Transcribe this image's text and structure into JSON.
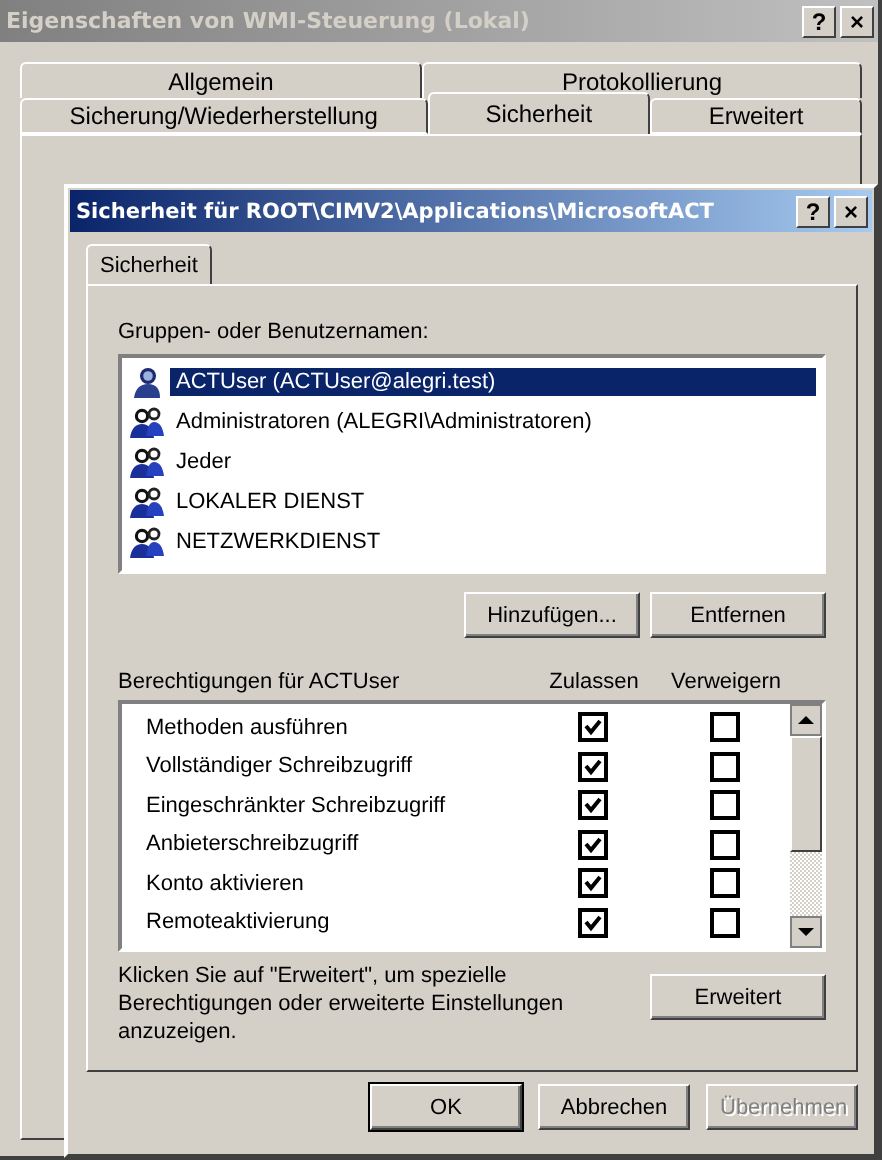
{
  "window": {
    "title": "Eigenschaften von WMI-Steuerung (Lokal)",
    "title_buttons": [
      "?",
      "×"
    ]
  },
  "tab_rows": [
    [
      {
        "label": "Allgemein",
        "selected": false
      },
      {
        "label": "Protokollierung",
        "selected": false
      }
    ],
    [
      {
        "label": "Sicherung/Wiederherstellung",
        "selected": false
      },
      {
        "label": "Sicherheit",
        "selected": true
      },
      {
        "label": "Erweitert",
        "selected": false
      }
    ]
  ],
  "dialog": {
    "title": "Sicherheit für ROOT\\CIMV2\\Applications\\MicrosoftACT",
    "title_buttons": [
      "?",
      "×"
    ],
    "tabs": [
      {
        "label": "Sicherheit",
        "selected": true
      }
    ],
    "users_label": "Gruppen- oder Benutzernamen:",
    "users": [
      {
        "name": "ACTUser (ACTUser@alegri.test)",
        "kind": "user",
        "selected": true
      },
      {
        "name": "Administratoren (ALEGRI\\Administratoren)",
        "kind": "group",
        "selected": false
      },
      {
        "name": "Jeder",
        "kind": "group",
        "selected": false
      },
      {
        "name": "LOKALER DIENST",
        "kind": "group",
        "selected": false
      },
      {
        "name": "NETZWERKDIENST",
        "kind": "group",
        "selected": false
      }
    ],
    "user_buttons": [
      "Hinzufügen...",
      "Entfernen"
    ],
    "permissions_label": "Berechtigungen für ACTUser",
    "allow_header": "Zulassen",
    "deny_header": "Verweigern",
    "permissions": [
      {
        "name": "Methoden ausführen",
        "allow": true,
        "deny": false
      },
      {
        "name": "Vollständiger Schreibzugriff",
        "allow": true,
        "deny": false
      },
      {
        "name": "Eingeschränkter Schreibzugriff",
        "allow": true,
        "deny": false
      },
      {
        "name": "Anbieterschreibzugriff",
        "allow": true,
        "deny": false
      },
      {
        "name": "Konto aktivieren",
        "allow": true,
        "deny": false
      },
      {
        "name": "Remoteaktivierung",
        "allow": true,
        "deny": false
      }
    ],
    "advanced_hint": "Klicken Sie auf \"Erweitert\", um spezielle Berechtigungen oder erweiterte Einstellungen anzuzeigen.",
    "advanced_button": "Erweitert",
    "buttons": [
      {
        "label": "OK",
        "disabled": false,
        "default": true
      },
      {
        "label": "Abbrechen",
        "disabled": false,
        "default": false
      },
      {
        "label": "Übernehmen",
        "disabled": true,
        "default": false
      }
    ]
  }
}
